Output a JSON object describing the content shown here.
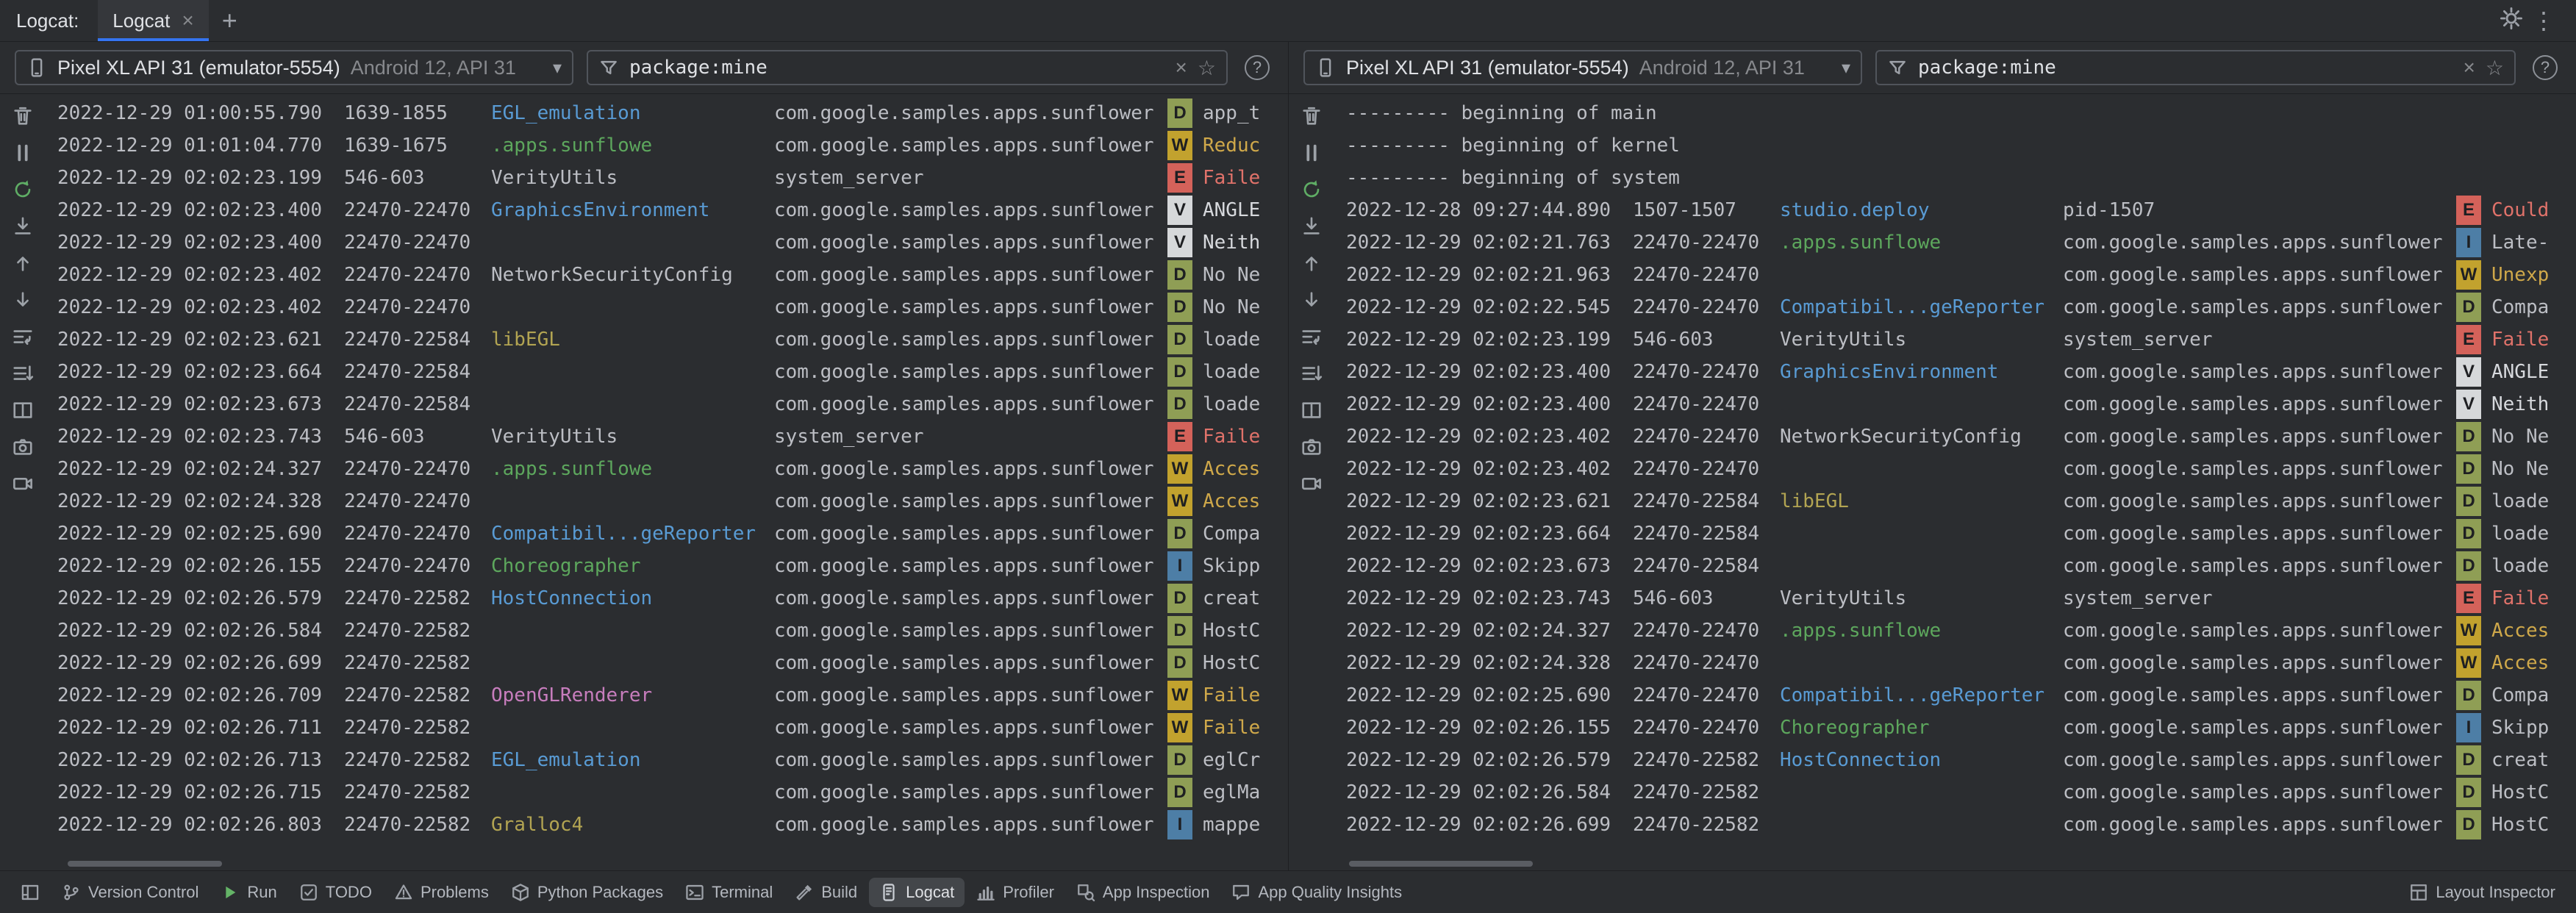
{
  "header": {
    "title": "Logcat:",
    "tab_label": "Logcat"
  },
  "icons": {
    "close": "×",
    "star": "☆",
    "chevron": "▾",
    "more": "⋮",
    "help": "?",
    "plus": "+"
  },
  "side_toolbar": [
    "clear-logcat",
    "pause-logcat",
    "restart-logcat",
    "scroll-to-end",
    "previous-occurrence",
    "next-occurrence",
    "soft-wrap",
    "formatting-options",
    "split-panels",
    "screenshot",
    "screen-record"
  ],
  "colors": {
    "levels": {
      "V": {
        "badge": "#d6d8da",
        "text": "#d7d9dd"
      },
      "D": {
        "badge": "#8f9e55",
        "text": "#bcbec4"
      },
      "I": {
        "badge": "#4d7ea6",
        "text": "#bcbec4"
      },
      "W": {
        "badge": "#c2a22e",
        "text": "#cfa84a"
      },
      "E": {
        "badge": "#d4625a",
        "text": "#e0726a"
      }
    },
    "tags": {
      "blue": "#599bd4",
      "green": "#5da75d",
      "yellow": "#b2a452",
      "magenta": "#c77dbd",
      "default": "#bcbec4"
    }
  },
  "panels": [
    {
      "device": {
        "name": "Pixel XL API 31 (emulator-5554)",
        "details": "Android 12, API 31"
      },
      "filter": {
        "value": "package:mine"
      },
      "rows": [
        {
          "time": "2022-12-29 01:00:55.790",
          "pid": "1639-1855",
          "tag": "EGL_emulation",
          "tag_color": "blue",
          "package": "com.google.samples.apps.sunflower",
          "level": "D",
          "message": "app_t"
        },
        {
          "time": "2022-12-29 01:01:04.770",
          "pid": "1639-1675",
          "tag": ".apps.sunflowe",
          "tag_color": "green",
          "package": "com.google.samples.apps.sunflower",
          "level": "W",
          "message": "Reduc"
        },
        {
          "time": "2022-12-29 02:02:23.199",
          "pid": "546-603",
          "tag": "VerityUtils",
          "tag_color": "default",
          "package": "system_server",
          "level": "E",
          "message": "Faile"
        },
        {
          "time": "2022-12-29 02:02:23.400",
          "pid": "22470-22470",
          "tag": "GraphicsEnvironment",
          "tag_color": "blue",
          "package": "com.google.samples.apps.sunflower",
          "level": "V",
          "message": "ANGLE"
        },
        {
          "time": "2022-12-29 02:02:23.400",
          "pid": "22470-22470",
          "tag": "",
          "tag_color": "default",
          "package": "com.google.samples.apps.sunflower",
          "level": "V",
          "message": "Neith"
        },
        {
          "time": "2022-12-29 02:02:23.402",
          "pid": "22470-22470",
          "tag": "NetworkSecurityConfig",
          "tag_color": "default",
          "package": "com.google.samples.apps.sunflower",
          "level": "D",
          "message": "No Ne"
        },
        {
          "time": "2022-12-29 02:02:23.402",
          "pid": "22470-22470",
          "tag": "",
          "tag_color": "default",
          "package": "com.google.samples.apps.sunflower",
          "level": "D",
          "message": "No Ne"
        },
        {
          "time": "2022-12-29 02:02:23.621",
          "pid": "22470-22584",
          "tag": "libEGL",
          "tag_color": "yellow",
          "package": "com.google.samples.apps.sunflower",
          "level": "D",
          "message": "loade"
        },
        {
          "time": "2022-12-29 02:02:23.664",
          "pid": "22470-22584",
          "tag": "",
          "tag_color": "default",
          "package": "com.google.samples.apps.sunflower",
          "level": "D",
          "message": "loade"
        },
        {
          "time": "2022-12-29 02:02:23.673",
          "pid": "22470-22584",
          "tag": "",
          "tag_color": "default",
          "package": "com.google.samples.apps.sunflower",
          "level": "D",
          "message": "loade"
        },
        {
          "time": "2022-12-29 02:02:23.743",
          "pid": "546-603",
          "tag": "VerityUtils",
          "tag_color": "default",
          "package": "system_server",
          "level": "E",
          "message": "Faile"
        },
        {
          "time": "2022-12-29 02:02:24.327",
          "pid": "22470-22470",
          "tag": ".apps.sunflowe",
          "tag_color": "green",
          "package": "com.google.samples.apps.sunflower",
          "level": "W",
          "message": "Acces"
        },
        {
          "time": "2022-12-29 02:02:24.328",
          "pid": "22470-22470",
          "tag": "",
          "tag_color": "default",
          "package": "com.google.samples.apps.sunflower",
          "level": "W",
          "message": "Acces"
        },
        {
          "time": "2022-12-29 02:02:25.690",
          "pid": "22470-22470",
          "tag": "Compatibil...geReporter",
          "tag_color": "blue",
          "package": "com.google.samples.apps.sunflower",
          "level": "D",
          "message": "Compa"
        },
        {
          "time": "2022-12-29 02:02:26.155",
          "pid": "22470-22470",
          "tag": "Choreographer",
          "tag_color": "green",
          "package": "com.google.samples.apps.sunflower",
          "level": "I",
          "message": "Skipp"
        },
        {
          "time": "2022-12-29 02:02:26.579",
          "pid": "22470-22582",
          "tag": "HostConnection",
          "tag_color": "blue",
          "package": "com.google.samples.apps.sunflower",
          "level": "D",
          "message": "creat"
        },
        {
          "time": "2022-12-29 02:02:26.584",
          "pid": "22470-22582",
          "tag": "",
          "tag_color": "default",
          "package": "com.google.samples.apps.sunflower",
          "level": "D",
          "message": "HostC"
        },
        {
          "time": "2022-12-29 02:02:26.699",
          "pid": "22470-22582",
          "tag": "",
          "tag_color": "default",
          "package": "com.google.samples.apps.sunflower",
          "level": "D",
          "message": "HostC"
        },
        {
          "time": "2022-12-29 02:02:26.709",
          "pid": "22470-22582",
          "tag": "OpenGLRenderer",
          "tag_color": "magenta",
          "package": "com.google.samples.apps.sunflower",
          "level": "W",
          "message": "Faile"
        },
        {
          "time": "2022-12-29 02:02:26.711",
          "pid": "22470-22582",
          "tag": "",
          "tag_color": "default",
          "package": "com.google.samples.apps.sunflower",
          "level": "W",
          "message": "Faile"
        },
        {
          "time": "2022-12-29 02:02:26.713",
          "pid": "22470-22582",
          "tag": "EGL_emulation",
          "tag_color": "blue",
          "package": "com.google.samples.apps.sunflower",
          "level": "D",
          "message": "eglCr"
        },
        {
          "time": "2022-12-29 02:02:26.715",
          "pid": "22470-22582",
          "tag": "",
          "tag_color": "default",
          "package": "com.google.samples.apps.sunflower",
          "level": "D",
          "message": "eglMa"
        },
        {
          "time": "2022-12-29 02:02:26.803",
          "pid": "22470-22582",
          "tag": "Gralloc4",
          "tag_color": "yellow",
          "package": "com.google.samples.apps.sunflower",
          "level": "I",
          "message": "mappe"
        }
      ]
    },
    {
      "device": {
        "name": "Pixel XL API 31 (emulator-5554)",
        "details": "Android 12, API 31"
      },
      "filter": {
        "value": "package:mine"
      },
      "rows": [
        {
          "banner": "--------- beginning of main"
        },
        {
          "banner": "--------- beginning of kernel"
        },
        {
          "banner": "--------- beginning of system"
        },
        {
          "time": "2022-12-28 09:27:44.890",
          "pid": "1507-1507",
          "tag": "studio.deploy",
          "tag_color": "blue",
          "package": "pid-1507",
          "level": "E",
          "message": "Could"
        },
        {
          "time": "2022-12-29 02:02:21.763",
          "pid": "22470-22470",
          "tag": ".apps.sunflowe",
          "tag_color": "green",
          "package": "com.google.samples.apps.sunflower",
          "level": "I",
          "message": "Late-"
        },
        {
          "time": "2022-12-29 02:02:21.963",
          "pid": "22470-22470",
          "tag": "",
          "tag_color": "default",
          "package": "com.google.samples.apps.sunflower",
          "level": "W",
          "message": "Unexp"
        },
        {
          "time": "2022-12-29 02:02:22.545",
          "pid": "22470-22470",
          "tag": "Compatibil...geReporter",
          "tag_color": "blue",
          "package": "com.google.samples.apps.sunflower",
          "level": "D",
          "message": "Compa"
        },
        {
          "time": "2022-12-29 02:02:23.199",
          "pid": "546-603",
          "tag": "VerityUtils",
          "tag_color": "default",
          "package": "system_server",
          "level": "E",
          "message": "Faile"
        },
        {
          "time": "2022-12-29 02:02:23.400",
          "pid": "22470-22470",
          "tag": "GraphicsEnvironment",
          "tag_color": "blue",
          "package": "com.google.samples.apps.sunflower",
          "level": "V",
          "message": "ANGLE"
        },
        {
          "time": "2022-12-29 02:02:23.400",
          "pid": "22470-22470",
          "tag": "",
          "tag_color": "default",
          "package": "com.google.samples.apps.sunflower",
          "level": "V",
          "message": "Neith"
        },
        {
          "time": "2022-12-29 02:02:23.402",
          "pid": "22470-22470",
          "tag": "NetworkSecurityConfig",
          "tag_color": "default",
          "package": "com.google.samples.apps.sunflower",
          "level": "D",
          "message": "No Ne"
        },
        {
          "time": "2022-12-29 02:02:23.402",
          "pid": "22470-22470",
          "tag": "",
          "tag_color": "default",
          "package": "com.google.samples.apps.sunflower",
          "level": "D",
          "message": "No Ne"
        },
        {
          "time": "2022-12-29 02:02:23.621",
          "pid": "22470-22584",
          "tag": "libEGL",
          "tag_color": "yellow",
          "package": "com.google.samples.apps.sunflower",
          "level": "D",
          "message": "loade"
        },
        {
          "time": "2022-12-29 02:02:23.664",
          "pid": "22470-22584",
          "tag": "",
          "tag_color": "default",
          "package": "com.google.samples.apps.sunflower",
          "level": "D",
          "message": "loade"
        },
        {
          "time": "2022-12-29 02:02:23.673",
          "pid": "22470-22584",
          "tag": "",
          "tag_color": "default",
          "package": "com.google.samples.apps.sunflower",
          "level": "D",
          "message": "loade"
        },
        {
          "time": "2022-12-29 02:02:23.743",
          "pid": "546-603",
          "tag": "VerityUtils",
          "tag_color": "default",
          "package": "system_server",
          "level": "E",
          "message": "Faile"
        },
        {
          "time": "2022-12-29 02:02:24.327",
          "pid": "22470-22470",
          "tag": ".apps.sunflowe",
          "tag_color": "green",
          "package": "com.google.samples.apps.sunflower",
          "level": "W",
          "message": "Acces"
        },
        {
          "time": "2022-12-29 02:02:24.328",
          "pid": "22470-22470",
          "tag": "",
          "tag_color": "default",
          "package": "com.google.samples.apps.sunflower",
          "level": "W",
          "message": "Acces"
        },
        {
          "time": "2022-12-29 02:02:25.690",
          "pid": "22470-22470",
          "tag": "Compatibil...geReporter",
          "tag_color": "blue",
          "package": "com.google.samples.apps.sunflower",
          "level": "D",
          "message": "Compa"
        },
        {
          "time": "2022-12-29 02:02:26.155",
          "pid": "22470-22470",
          "tag": "Choreographer",
          "tag_color": "green",
          "package": "com.google.samples.apps.sunflower",
          "level": "I",
          "message": "Skipp"
        },
        {
          "time": "2022-12-29 02:02:26.579",
          "pid": "22470-22582",
          "tag": "HostConnection",
          "tag_color": "blue",
          "package": "com.google.samples.apps.sunflower",
          "level": "D",
          "message": "creat"
        },
        {
          "time": "2022-12-29 02:02:26.584",
          "pid": "22470-22582",
          "tag": "",
          "tag_color": "default",
          "package": "com.google.samples.apps.sunflower",
          "level": "D",
          "message": "HostC"
        },
        {
          "time": "2022-12-29 02:02:26.699",
          "pid": "22470-22582",
          "tag": "",
          "tag_color": "default",
          "package": "com.google.samples.apps.sunflower",
          "level": "D",
          "message": "HostC"
        }
      ]
    }
  ],
  "bottom_bar": {
    "left": [
      {
        "icon": "toolwindows",
        "label": ""
      },
      {
        "icon": "version-control",
        "label": "Version Control"
      },
      {
        "icon": "run",
        "label": "Run"
      },
      {
        "icon": "todo",
        "label": "TODO"
      },
      {
        "icon": "problems",
        "label": "Problems"
      },
      {
        "icon": "python-packages",
        "label": "Python Packages"
      },
      {
        "icon": "terminal",
        "label": "Terminal"
      },
      {
        "icon": "build",
        "label": "Build"
      },
      {
        "icon": "logcat",
        "label": "Logcat",
        "active": true
      },
      {
        "icon": "profiler",
        "label": "Profiler"
      },
      {
        "icon": "app-inspection",
        "label": "App Inspection"
      },
      {
        "icon": "app-quality-insights",
        "label": "App Quality Insights"
      }
    ],
    "right": [
      {
        "icon": "layout-inspector",
        "label": "Layout Inspector"
      }
    ]
  }
}
